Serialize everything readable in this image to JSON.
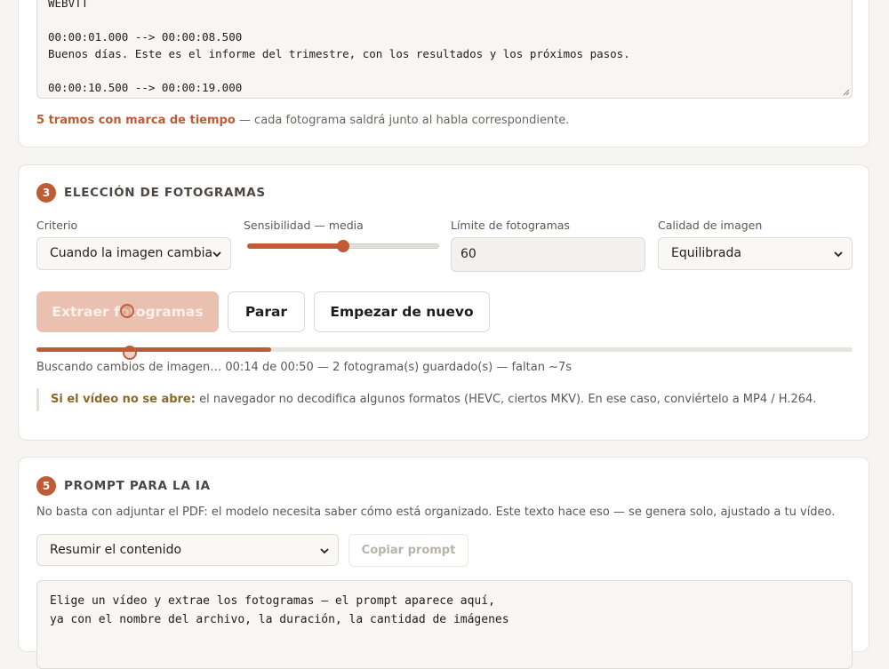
{
  "vtt": {
    "lines": [
      "WEBVTT",
      "",
      "00:00:01.000 --> 00:00:08.500",
      "Buenos días. Este es el informe del trimestre, con los resultados y los próximos pasos.",
      "",
      "00:00:10.500 --> 00:00:19.000"
    ],
    "status_count": "5 tramos con marca de tiempo",
    "status_rest": " — cada fotograma saldrá junto al habla correspondiente."
  },
  "frames": {
    "step": "3",
    "title": "ELECCIÓN DE FOTOGRAMAS",
    "criterio_label": "Criterio",
    "criterio_value": "Cuando la imagen cambia",
    "sens_label": "Sensibilidad — media",
    "sens_level": 0.5,
    "limite_label": "Límite de fotogramas",
    "limite_value": "60",
    "calidad_label": "Calidad de imagen",
    "calidad_value": "Equilibrada",
    "extract_label": "Extraer fotogramas",
    "stop_label": "Parar",
    "restart_label": "Empezar de nuevo",
    "progress": 0.288,
    "progress_text": "Buscando cambios de imagen… 00:14 de 00:50 — 2 fotograma(s) guardado(s) — faltan ~7s",
    "note_lead": "Si el vídeo no se abre:",
    "note_text": " el navegador no decodifica algunos formatos (HEVC, ciertos MKV). En ese caso, conviértelo a MP4 / H.264."
  },
  "prompt": {
    "step": "5",
    "title": "PROMPT PARA LA IA",
    "desc": "No basta con adjuntar el PDF: el modelo necesita saber cómo está organizado. Este texto hace eso — se genera solo, ajustado a tu vídeo.",
    "mode_value": "Resumir el contenido",
    "copy_label": "Copiar prompt",
    "text": "Elige un vídeo y extrae los fotogramas — el prompt aparece aquí,\nya con el nombre del archivo, la duración, la cantidad de imágenes"
  },
  "colors": {
    "accent": "#bf5b35",
    "accent_soft": "#eac0b0"
  },
  "icons": {
    "select_arrow": "chevron-down-icon",
    "resize": "resize-grip-icon"
  }
}
